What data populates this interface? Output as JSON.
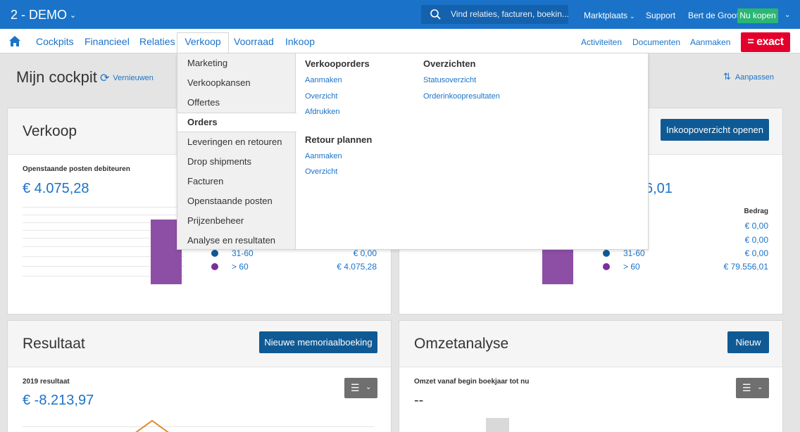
{
  "topbar": {
    "company": "2 - DEMO",
    "search_placeholder": "Vind relaties, facturen, boekin...",
    "links": [
      "Marktplaats",
      "Support",
      "Bert de Groot"
    ],
    "buy_button": "Nu kopen"
  },
  "nav": {
    "items": [
      "Cockpits",
      "Financieel",
      "Relaties",
      "Verkoop",
      "Voorraad",
      "Inkoop"
    ],
    "active": "Verkoop",
    "right": [
      "Activiteiten",
      "Documenten",
      "Aanmaken"
    ],
    "logo": "= exact"
  },
  "page": {
    "title": "Mijn cockpit",
    "refresh": "Vernieuwen",
    "customize": "Aanpassen"
  },
  "cards": {
    "verkoop": {
      "title": "Verkoop",
      "subtitle": "Openstaande posten debiteuren",
      "total": "€ 4.075,28",
      "legend": [
        {
          "label": "31-60",
          "amount": "€ 0,00",
          "color": "#0f5a94"
        },
        {
          "label": "> 60",
          "amount": "€ 4.075,28",
          "color": "#7b2f9c"
        }
      ]
    },
    "inkoop": {
      "button": "Inkoopoverzicht openen",
      "total_suffix": "6,01",
      "column": "Bedrag",
      "amounts": [
        "€ 0,00",
        "€ 0,00"
      ],
      "legend": [
        {
          "label": "31-60",
          "amount": "€ 0,00",
          "color": "#0f5a94"
        },
        {
          "label": "> 60",
          "amount": "€ 79.556,01",
          "color": "#7b2f9c"
        }
      ]
    },
    "resultaat": {
      "title": "Resultaat",
      "button": "Nieuwe memoriaalboeking",
      "subtitle": "2019 resultaat",
      "total": "€ -8.213,97"
    },
    "omzet": {
      "title": "Omzetanalyse",
      "button": "Nieuw",
      "subtitle": "Omzet vanaf begin boekjaar tot nu",
      "total": "--"
    }
  },
  "dropdown": {
    "left_items": [
      "Marketing",
      "Verkoopkansen",
      "Offertes",
      "Orders",
      "Leveringen en retouren",
      "Drop shipments",
      "Facturen",
      "Openstaande posten",
      "Prijzenbeheer",
      "Analyse en resultaten"
    ],
    "selected": "Orders",
    "verkooporders": {
      "title": "Verkooporders",
      "links": [
        "Aanmaken",
        "Overzicht",
        "Afdrukken"
      ]
    },
    "overzichten": {
      "title": "Overzichten",
      "links": [
        "Statusoverzicht",
        "Orderinkoopresultaten"
      ]
    },
    "retour": {
      "title": "Retour plannen",
      "links": [
        "Aanmaken",
        "Overzicht"
      ]
    }
  },
  "colors": {
    "brand": "#1a73c8",
    "exact_red": "#e4002b",
    "buy_green": "#2bb673",
    "bar_purple": "#8d4fa6"
  }
}
